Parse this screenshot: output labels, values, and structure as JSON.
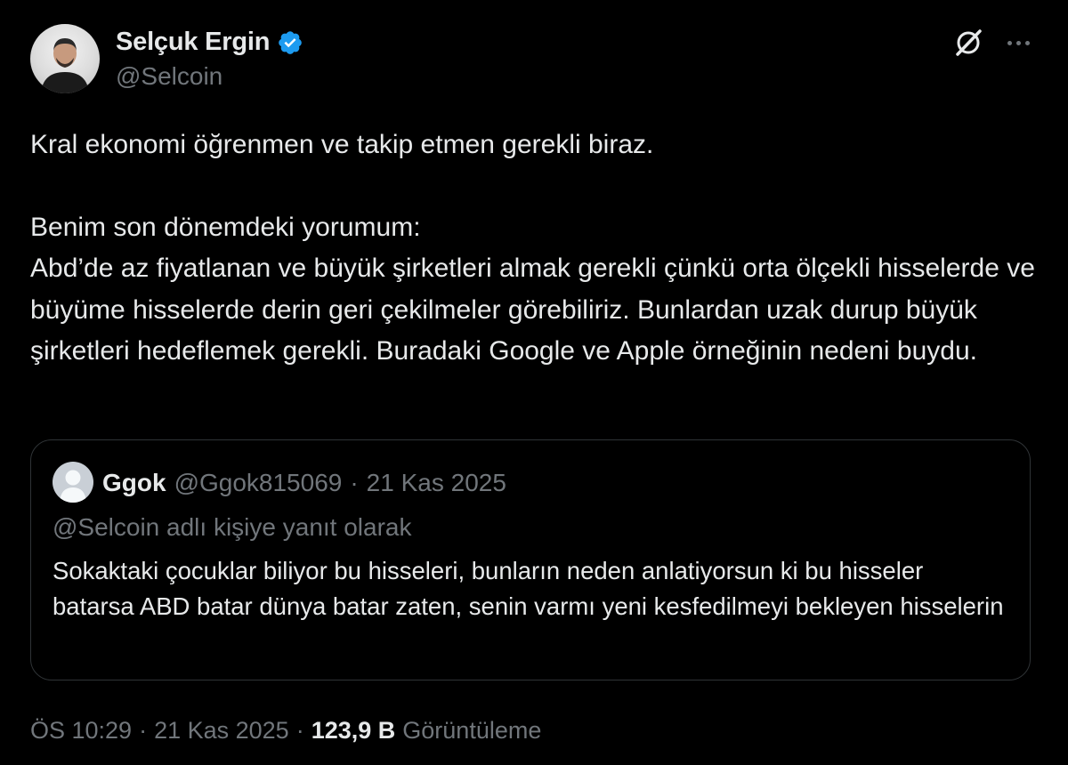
{
  "author": {
    "display_name": "Selçuk Ergin",
    "handle": "@Selcoin",
    "verified": true,
    "avatar_icon": "profile-photo"
  },
  "actions": {
    "grok_icon": "grok-icon",
    "more_icon": "more-options-icon"
  },
  "tweet": {
    "paragraphs": [
      "Kral ekonomi öğrenmen ve takip etmen gerekli biraz.",
      "Benim son dönemdeki yorumum:",
      "Abd’de az fiyatlanan ve büyük şirketleri almak gerekli çünkü orta ölçekli hisselerde ve büyüme hisselerde derin geri çekilmeler görebiliriz. Bunlardan uzak durup büyük şirketleri hedeflemek gerekli. Buradaki Google ve Apple örneğinin nedeni buydu."
    ]
  },
  "quoted": {
    "name": "Ggok",
    "handle": "@Ggok815069",
    "separator": "·",
    "date": "21 Kas 2025",
    "reply_context": "@Selcoin adlı kişiye yanıt olarak",
    "text": "Sokaktaki çocuklar biliyor bu hisseleri, bunların neden anlatiyorsun ki bu hisseler batarsa ABD batar dünya batar zaten, senin varmı yeni kesfedilmeyi bekleyen hisselerin"
  },
  "meta": {
    "time": "ÖS 10:29",
    "separator": "·",
    "date": "21 Kas 2025",
    "views_count": "123,9 B",
    "views_label": "Görüntüleme"
  },
  "colors": {
    "background": "#000000",
    "text_primary": "#e7e9ea",
    "text_secondary": "#71767b",
    "verified_blue": "#1d9bf0",
    "border": "#2f3336"
  }
}
